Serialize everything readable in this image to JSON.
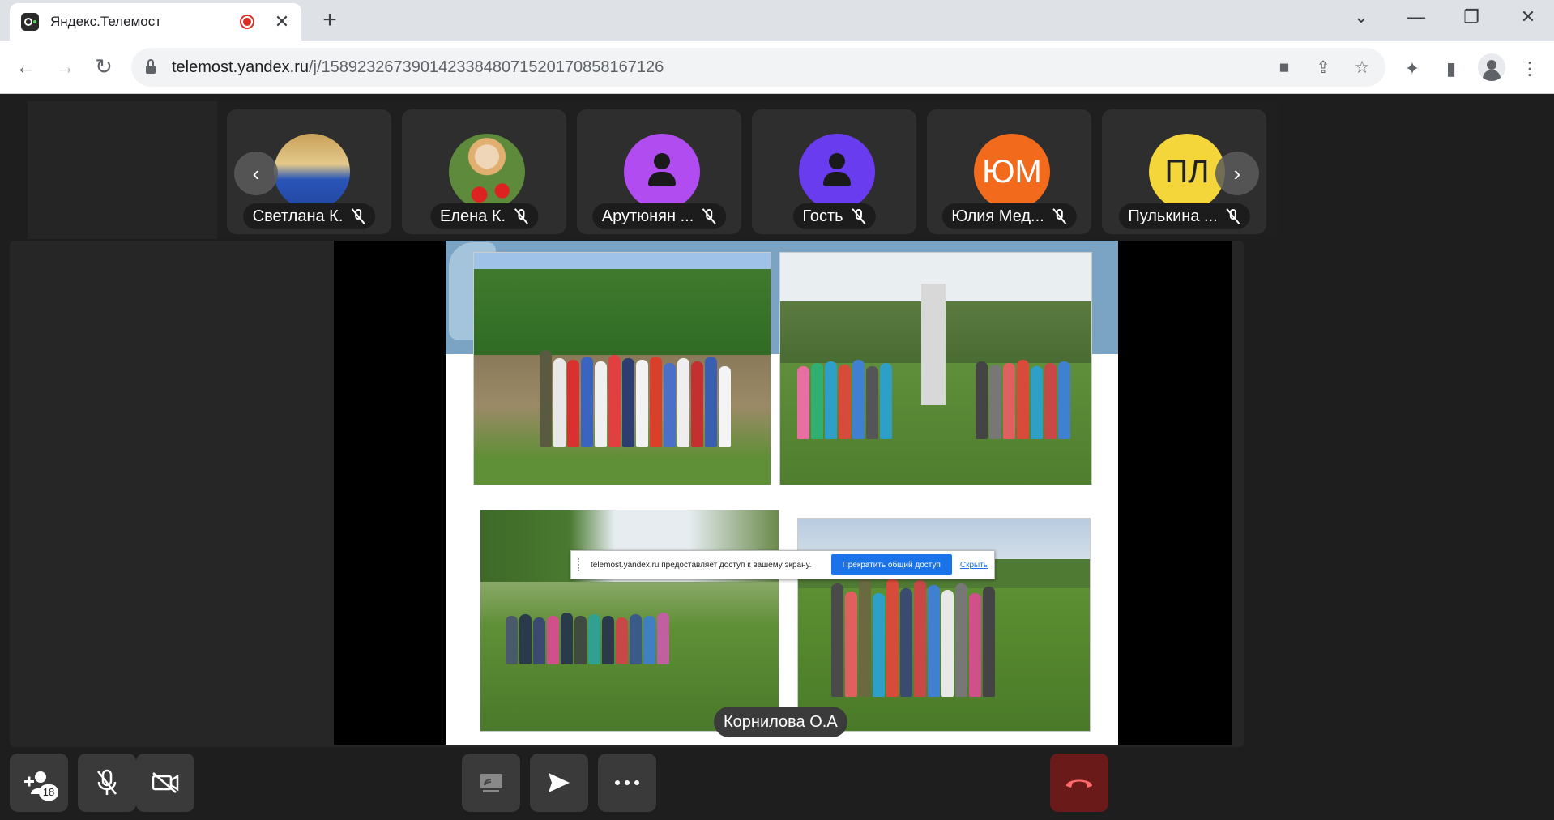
{
  "browser": {
    "tab_title": "Яндекс.Телемост",
    "url_host": "telemost.yandex.ru",
    "url_path": "/j/15892326739014233848071520170858167126"
  },
  "participants": [
    {
      "name": "Светлана К.",
      "initials": "",
      "avatar_color": "#c9a15a",
      "avatar_type": "photo"
    },
    {
      "name": "Елена К.",
      "initials": "",
      "avatar_color": "#6e9a4a",
      "avatar_type": "photo"
    },
    {
      "name": "Арутюнян ...",
      "initials": "",
      "avatar_color": "#b04cf0",
      "avatar_type": "person"
    },
    {
      "name": "Гость",
      "initials": "",
      "avatar_color": "#6a3cf0",
      "avatar_type": "person"
    },
    {
      "name": "Юлия Мед...",
      "initials": "ЮМ",
      "avatar_color": "#f26b1d",
      "avatar_type": "initials"
    },
    {
      "name": "Пулькина ...",
      "initials": "ПЛ",
      "avatar_color": "#f5d63a",
      "avatar_type": "initials"
    }
  ],
  "screen_share": {
    "banner_text": "telemost.yandex.ru предоставляет доступ к вашему экрану.",
    "stop_label": "Прекратить общий доступ",
    "hide_label": "Скрыть"
  },
  "speaker": {
    "name": "Корнилова О.А"
  },
  "toolbar": {
    "participants_count": "18"
  }
}
